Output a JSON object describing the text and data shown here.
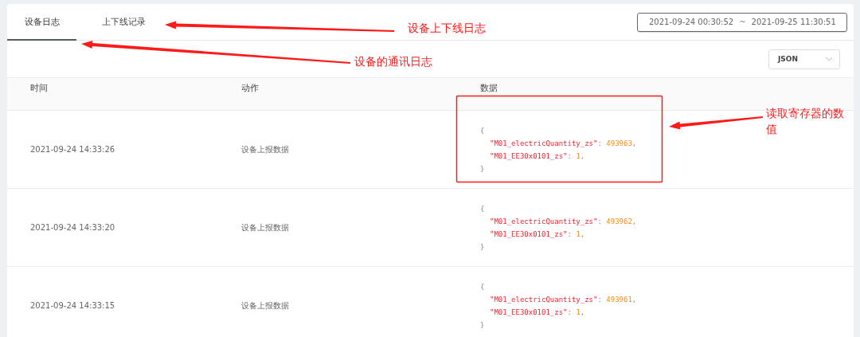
{
  "tabs": [
    {
      "label": "设备日志",
      "selected": true
    },
    {
      "label": "上下线记录",
      "selected": false
    }
  ],
  "date_range": {
    "start": "2021-09-24 00:30:52",
    "separator": "~",
    "end": "2021-09-25 11:30:51"
  },
  "format_select": {
    "value": "JSON"
  },
  "table": {
    "columns": [
      "时间",
      "动作",
      "数据"
    ],
    "rows": [
      {
        "time": "2021-09-24 14:33:26",
        "action": "设备上报数据",
        "open": "{",
        "close": "}",
        "fields": [
          {
            "key": "\"M01_electricQuantity_zs\"",
            "colon": ":",
            "value": "493963",
            "comma": ","
          },
          {
            "key": "\"M01_EE30x0101_zs\"",
            "colon": ":",
            "value": "1",
            "comma": ","
          }
        ]
      },
      {
        "time": "2021-09-24 14:33:20",
        "action": "设备上报数据",
        "open": "{",
        "close": "}",
        "fields": [
          {
            "key": "\"M01_electricQuantity_zs\"",
            "colon": ":",
            "value": "493962",
            "comma": ","
          },
          {
            "key": "\"M01_EE30x0101_zs\"",
            "colon": ":",
            "value": "1",
            "comma": ","
          }
        ]
      },
      {
        "time": "2021-09-24 14:33:15",
        "action": "设备上报数据",
        "open": "{",
        "close": "}",
        "fields": [
          {
            "key": "\"M01_electricQuantity_zs\"",
            "colon": ":",
            "value": "493961",
            "comma": ","
          },
          {
            "key": "\"M01_EE30x0101_zs\"",
            "colon": ":",
            "value": "1",
            "comma": ","
          }
        ]
      }
    ]
  },
  "annotations": [
    {
      "text": "设备上下线日志"
    },
    {
      "text": "设备的通讯日志"
    },
    {
      "text": "读取寄存器的数值"
    }
  ]
}
